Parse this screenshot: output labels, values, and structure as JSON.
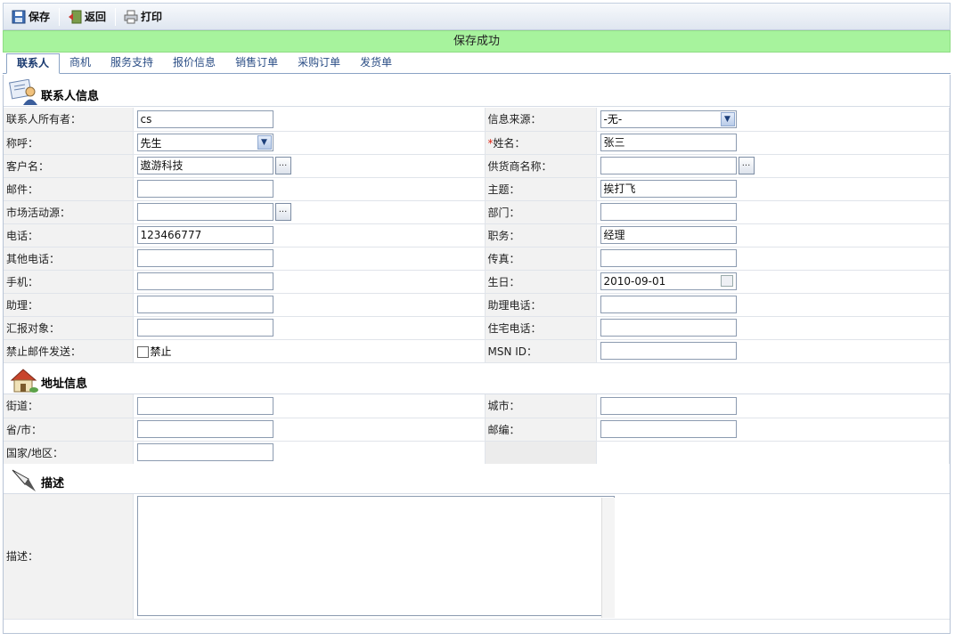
{
  "toolbar": {
    "save": "保存",
    "back": "返回",
    "print": "打印"
  },
  "banner": "保存成功",
  "tabs": [
    "联系人",
    "商机",
    "服务支持",
    "报价信息",
    "销售订单",
    "采购订单",
    "发货单"
  ],
  "sections": {
    "contact": "联系人信息",
    "address": "地址信息",
    "description": "描述"
  },
  "contact": {
    "owner_label": "联系人所有者：",
    "owner_value": "cs",
    "source_label": "信息来源：",
    "source_value": "-无-",
    "salutation_label": "称呼：",
    "salutation_value": "先生",
    "name_required": "*",
    "name_label": "姓名：",
    "name_value": "张三",
    "customer_label": "客户名：",
    "customer_value": "遨游科技",
    "supplier_label": "供货商名称：",
    "supplier_value": "",
    "email_label": "邮件：",
    "email_value": "",
    "subject_label": "主题：",
    "subject_value": "挨打飞",
    "campaign_label": "市场活动源：",
    "campaign_value": "",
    "department_label": "部门：",
    "department_value": "",
    "phone_label": "电话：",
    "phone_value": "123466777",
    "title_label": "职务：",
    "title_value": "经理",
    "otherphone_label": "其他电话：",
    "otherphone_value": "",
    "fax_label": "传真：",
    "fax_value": "",
    "mobile_label": "手机：",
    "mobile_value": "",
    "birthday_label": "生日：",
    "birthday_value": "2010-09-01",
    "assistant_label": "助理：",
    "assistant_value": "",
    "assistantphone_label": "助理电话：",
    "assistantphone_value": "",
    "reportsto_label": "汇报对象：",
    "reportsto_value": "",
    "homephone_label": "住宅电话：",
    "homephone_value": "",
    "noemail_label": "禁止邮件发送：",
    "noemail_check": "禁止",
    "msn_label": "MSN ID：",
    "msn_value": ""
  },
  "address": {
    "street_label": "街道：",
    "street_value": "",
    "city_label": "城市：",
    "city_value": "",
    "province_label": "省/市：",
    "province_value": "",
    "zip_label": "邮编：",
    "zip_value": "",
    "country_label": "国家/地区：",
    "country_value": ""
  },
  "description": {
    "label": "描述：",
    "value": ""
  },
  "lookup_button": "..."
}
